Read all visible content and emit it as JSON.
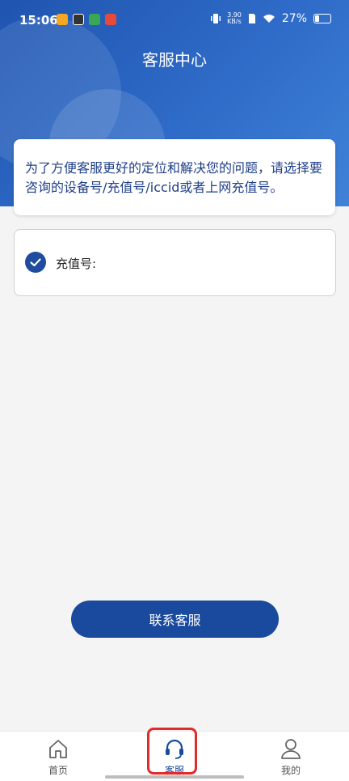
{
  "status_bar": {
    "time": "15:06",
    "net_speed_value": "3.90",
    "net_speed_unit": "KB/s",
    "battery": "27%"
  },
  "header": {
    "title": "客服中心"
  },
  "info": {
    "text": "为了方便客服更好的定位和解决您的问题，请选择要咨询的设备号/充值号/iccid或者上网充值号。"
  },
  "selection": {
    "label": "充值号:",
    "checked": true
  },
  "contact_button": {
    "label": "联系客服"
  },
  "tabbar": {
    "items": [
      {
        "label": "首页",
        "icon": "home-icon",
        "active": false
      },
      {
        "label": "客服",
        "icon": "headset-icon",
        "active": true
      },
      {
        "label": "我的",
        "icon": "user-icon",
        "active": false
      }
    ]
  },
  "colors": {
    "primary": "#1a4a9e",
    "header_gradient_start": "#1f55b0",
    "header_gradient_end": "#3f82d8",
    "highlight": "#e32a2a"
  }
}
